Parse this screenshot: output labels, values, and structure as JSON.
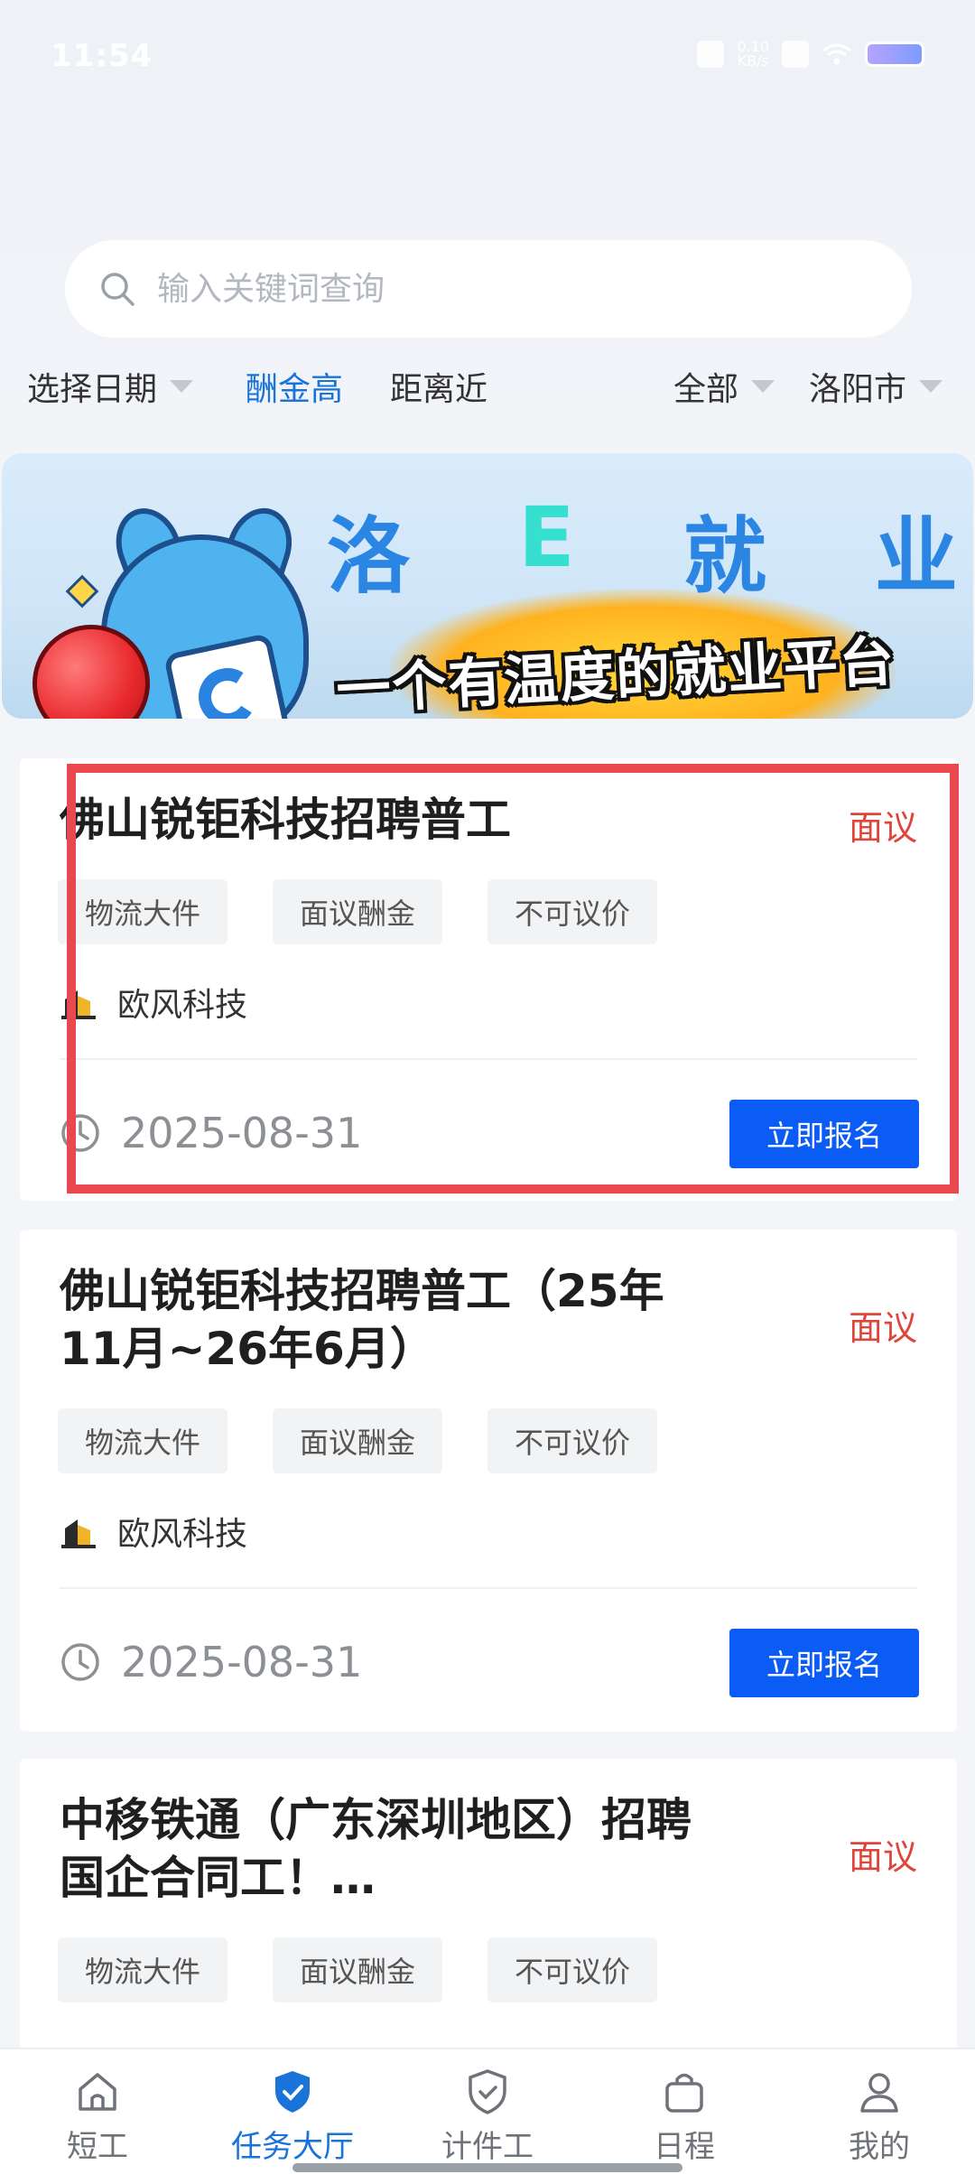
{
  "status_bar": {
    "time": "11:54",
    "network_speed_value": "0.10",
    "network_speed_unit": "KB/s"
  },
  "search": {
    "placeholder": "输入关键词查询"
  },
  "filters": {
    "date": "选择日期",
    "pay_high": "酬金高",
    "distance_near": "距离近",
    "all": "全部",
    "city": "洛阳市"
  },
  "banner": {
    "title_chars": [
      "洛",
      "E",
      "就",
      "业"
    ],
    "slogan": "一个有温度的就业平台"
  },
  "jobs": [
    {
      "title": "佛山锐钜科技招聘普工",
      "price": "面议",
      "tags": [
        "物流大件",
        "面议酬金",
        "不可议价"
      ],
      "company": "欧风科技",
      "date": "2025-08-31",
      "apply_label": "立即报名"
    },
    {
      "title": "佛山锐钜科技招聘普工（25年11月~26年6月）",
      "price": "面议",
      "tags": [
        "物流大件",
        "面议酬金",
        "不可议价"
      ],
      "company": "欧风科技",
      "date": "2025-08-31",
      "apply_label": "立即报名"
    },
    {
      "title": "中移铁通（广东深圳地区）招聘国企合同工！…",
      "price": "面议",
      "tags": [
        "物流大件",
        "面议酬金",
        "不可议价"
      ]
    }
  ],
  "bottom_nav": [
    {
      "label": "短工",
      "icon": "home-icon"
    },
    {
      "label": "任务大厅",
      "icon": "shield-check-icon",
      "active": true
    },
    {
      "label": "计件工",
      "icon": "shield-outline-icon"
    },
    {
      "label": "日程",
      "icon": "bag-icon"
    },
    {
      "label": "我的",
      "icon": "user-icon"
    }
  ],
  "colors": {
    "accent": "#1a73d9",
    "apply_button": "#0a5cf5",
    "price": "#e0453c",
    "highlight_box": "#e8484e"
  }
}
